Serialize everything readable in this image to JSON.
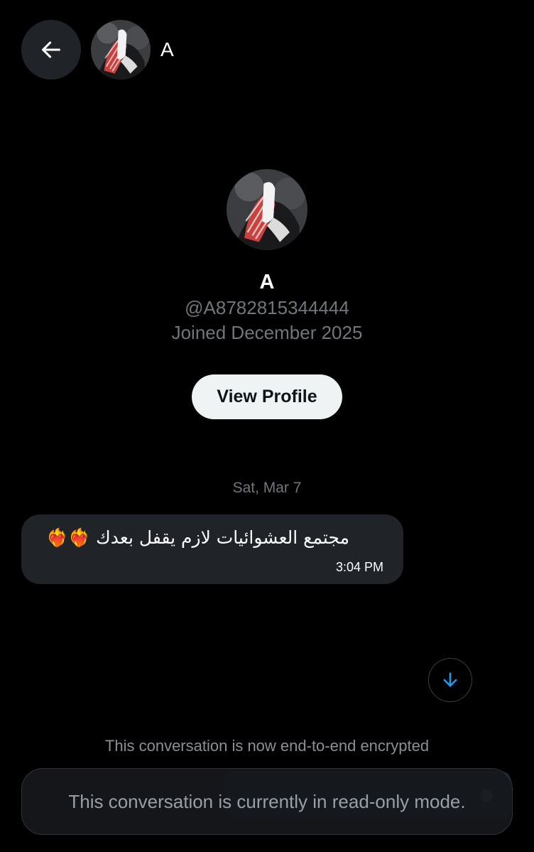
{
  "header": {
    "name": "A"
  },
  "profile": {
    "name": "A",
    "handle": "@A8782815344444",
    "joined": "Joined December 2025",
    "view_profile_label": "View Profile"
  },
  "conversation": {
    "date_separator": "Sat, Mar 7",
    "messages": [
      {
        "text": "مجتمع العشوائيات لازم يقفل بعدك ❤️‍🔥❤️‍🔥",
        "time": "3:04 PM"
      }
    ],
    "encrypted_notice": "This conversation is now end-to-end encrypted",
    "readonly_notice": "This conversation is currently in read-only mode."
  },
  "icons": {
    "back": "arrow-left-icon",
    "scroll_down": "arrow-down-icon"
  },
  "colors": {
    "background": "#000000",
    "bubble": "#202327",
    "muted_text": "#71767b",
    "accent": "#1d9bf0",
    "button_bg": "#eff3f4"
  }
}
